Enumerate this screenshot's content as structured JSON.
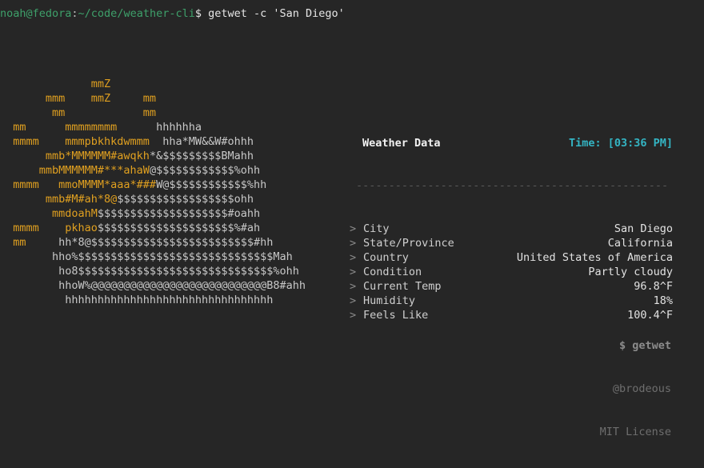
{
  "terminal": {
    "background": "#262626",
    "foreground": "#d0d0d0"
  },
  "prompt": {
    "user_host": "noah@fedora",
    "separator": ":",
    "path": "~/code/weather-cli",
    "sigil": "$ ",
    "command": "getwet -c 'San Diego'",
    "user_color": "#3ea06a",
    "path_color": "#3ea06a",
    "command_color": "#e6e6e6"
  },
  "ascii_art": {
    "sun_color": "#e0a020",
    "sun_light_color": "#f0c040",
    "cloud_color": "#c8c8c8",
    "cloud_dim_color": "#a8a8a8",
    "lines": [
      [
        {
          "t": "              mmZ",
          "c": "sun"
        }
      ],
      [
        {
          "t": "       mmm    mmZ     mm",
          "c": "sun"
        }
      ],
      [
        {
          "t": "        mm            mm",
          "c": "sun"
        }
      ],
      [
        {
          "t": "  mm      mmmmmmmm",
          "c": "sun"
        },
        {
          "t": "      hhhhhha",
          "c": "cloud"
        }
      ],
      [
        {
          "t": "  mmmm    mmmpbkhkdwmmm",
          "c": "sun"
        },
        {
          "t": "  hha*MW&&W#ohhh",
          "c": "cloud"
        }
      ],
      [
        {
          "t": "       mmb*MMMMMM#awqkh",
          "c": "sun"
        },
        {
          "t": "*&$$$$$$$$$BMahh",
          "c": "cloud"
        }
      ],
      [
        {
          "t": "      mmbMMMMMM#***ahaW",
          "c": "sun"
        },
        {
          "t": "@$$$$$$$$$$$$%ohh",
          "c": "cloud"
        }
      ],
      [
        {
          "t": "  mmmm   mmoMMMM*aaa*###",
          "c": "sun"
        },
        {
          "t": "W@$$$$$$$$$$$$%hh",
          "c": "cloud"
        }
      ],
      [
        {
          "t": "       mmb#M#ah*8@",
          "c": "sun"
        },
        {
          "t": "$$$$$$$$$$$$$$$$$$ohh",
          "c": "cloud"
        }
      ],
      [
        {
          "t": "        mmdoahM",
          "c": "sun"
        },
        {
          "t": "$$$$$$$$$$$$$$$$$$$$#oahh",
          "c": "cloud"
        }
      ],
      [
        {
          "t": "  mmmm    pkhao",
          "c": "sun"
        },
        {
          "t": "$$$$$$$$$$$$$$$$$$$$$%#ah",
          "c": "cloud"
        }
      ],
      [
        {
          "t": "  mm",
          "c": "sun"
        },
        {
          "t": "     hh*8@$$$$$$$$$$$$$$$$$$$$$$$$$#hh",
          "c": "cloud"
        }
      ],
      [
        {
          "t": "        hho%$$$$$$$$$$$$$$$$$$$$$$$$$$$$$$Mah",
          "c": "cloud"
        }
      ],
      [
        {
          "t": "         ho8$$$$$$$$$$$$$$$$$$$$$$$$$$$$$$%ohh",
          "c": "cloud"
        }
      ],
      [
        {
          "t": "         hhoW%@@@@@@@@@@@@@@@@@@@@@@@@@@@B8#ahh",
          "c": "cloud"
        }
      ],
      [
        {
          "t": "          hhhhhhhhhhhhhhhhhhhhhhhhhhhhhhhh",
          "c": "cloud"
        }
      ]
    ]
  },
  "panel": {
    "title": "Weather Data",
    "time_label": "Time:",
    "time_value": "[03:36 PM]",
    "time_color": "#34b5c4",
    "divider": "------------------------------------------------",
    "row_marker": ">",
    "rows": [
      {
        "label": "City",
        "value": "San Diego"
      },
      {
        "label": "State/Province",
        "value": "California"
      },
      {
        "label": "Country",
        "value": "United States of America"
      },
      {
        "label": "Condition",
        "value": "Partly cloudy"
      },
      {
        "label": "Current Temp",
        "value": "96.8^F"
      },
      {
        "label": "Humidity",
        "value": "18%"
      },
      {
        "label": "Feels Like",
        "value": "100.4^F"
      }
    ]
  },
  "footer": {
    "command": "$ getwet",
    "handle": "@brodeous",
    "license": "MIT License"
  }
}
